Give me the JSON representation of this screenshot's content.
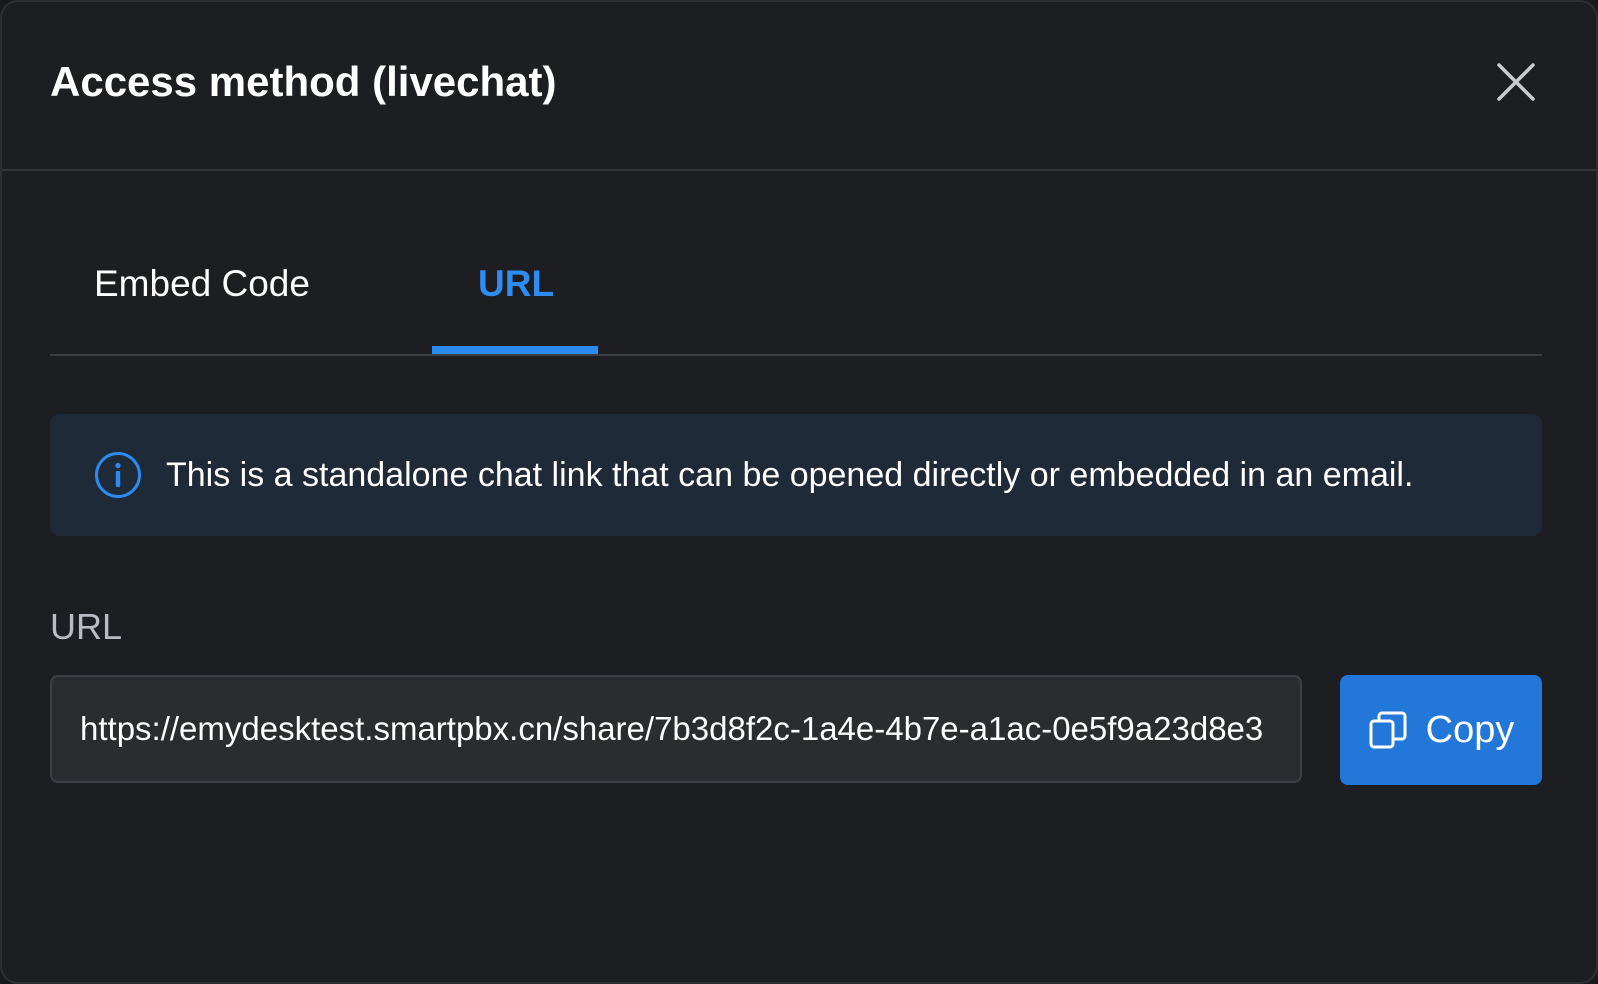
{
  "modal": {
    "title": "Access method (livechat)",
    "close_icon": "close-icon"
  },
  "tabs": [
    {
      "label": "Embed Code",
      "active": false
    },
    {
      "label": "URL",
      "active": true
    }
  ],
  "info": {
    "icon": "info-icon",
    "text": "This is a standalone chat link that can be opened directly or embedded in an email."
  },
  "url_field": {
    "label": "URL",
    "value": "https://emydesktest.smartpbx.cn/share/7b3d8f2c-1a4e-4b7e-a1ac-0e5f9a23d8e3"
  },
  "copy_button": {
    "label": "Copy",
    "icon": "copy-icon"
  },
  "colors": {
    "accent": "#2b8bf0",
    "button": "#2277d9",
    "background": "#1c1e22",
    "banner": "#1e2a38"
  }
}
